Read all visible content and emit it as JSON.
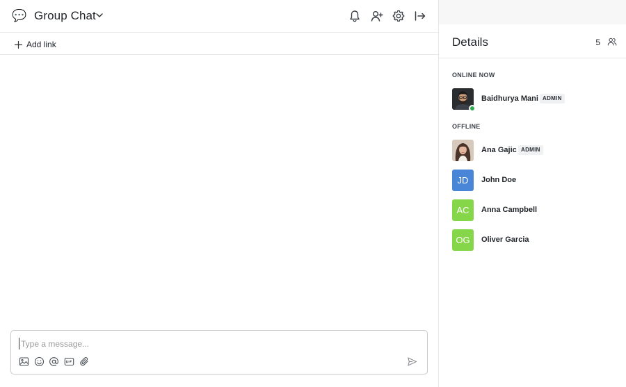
{
  "chat": {
    "emoji": "💬",
    "title": "Group Chat",
    "add_link_label": "Add link",
    "composer_placeholder": "Type a message...",
    "composer_value": ""
  },
  "details": {
    "title": "Details",
    "member_count": "5",
    "online_label": "ONLINE NOW",
    "offline_label": "OFFLINE",
    "online_members": [
      {
        "name": "Baidhurya Mani",
        "badge": "ADMIN",
        "online": true
      }
    ],
    "offline_members": [
      {
        "name": "Ana Gajic",
        "badge": "ADMIN"
      },
      {
        "name": "John Doe",
        "initials": "JD",
        "color": "#4a86d8"
      },
      {
        "name": "Anna Campbell",
        "initials": "AC",
        "color": "#86d64a"
      },
      {
        "name": "Oliver Garcia",
        "initials": "OG",
        "color": "#86d64a"
      }
    ]
  },
  "colors": {
    "presence_online": "#2fa84f",
    "divider": "#e8e8e8",
    "badge_bg": "#f0f1f3"
  },
  "icons": {
    "header": [
      "bell-icon",
      "add-user-icon",
      "gear-icon",
      "exit-icon"
    ],
    "composer_tools": [
      "image-icon",
      "emoji-icon",
      "mention-icon",
      "gif-icon",
      "attachment-icon"
    ],
    "send": "send-icon"
  }
}
